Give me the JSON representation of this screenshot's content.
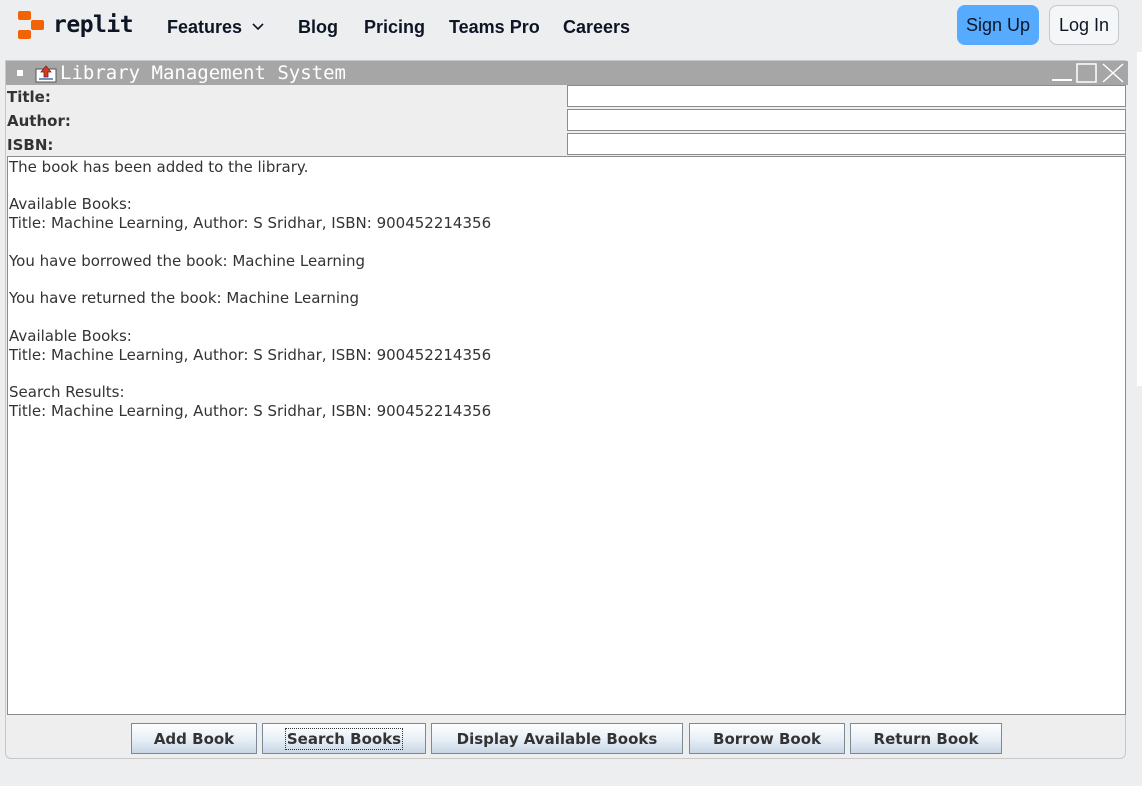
{
  "nav": {
    "brand": "replit",
    "links": [
      "Features",
      "Blog",
      "Pricing",
      "Teams Pro",
      "Careers"
    ],
    "signup": "Sign Up",
    "login": "Log In"
  },
  "window": {
    "title": "Library Management System",
    "fields": [
      {
        "label": "Title:",
        "value": ""
      },
      {
        "label": "Author:",
        "value": ""
      },
      {
        "label": "ISBN:",
        "value": ""
      }
    ],
    "output_lines": [
      "The book has been added to the library.",
      "Available Books:",
      "Title: Machine Learning, Author: S Sridhar, ISBN: 900452214356",
      "You have borrowed the book: Machine Learning",
      "You have returned the book: Machine Learning",
      "Available Books:",
      "Title: Machine Learning, Author: S Sridhar, ISBN: 900452214356",
      "Search Results:",
      "Title: Machine Learning, Author: S Sridhar, ISBN: 900452214356"
    ],
    "buttons": [
      "Add Book",
      "Search Books",
      "Display Available Books",
      "Borrow Book",
      "Return Book"
    ],
    "focused_button": "Search Books"
  },
  "colors": {
    "brand_orange": "#f26207",
    "signup_blue": "#57abff",
    "titlebar_gray": "#a6a6a6"
  }
}
